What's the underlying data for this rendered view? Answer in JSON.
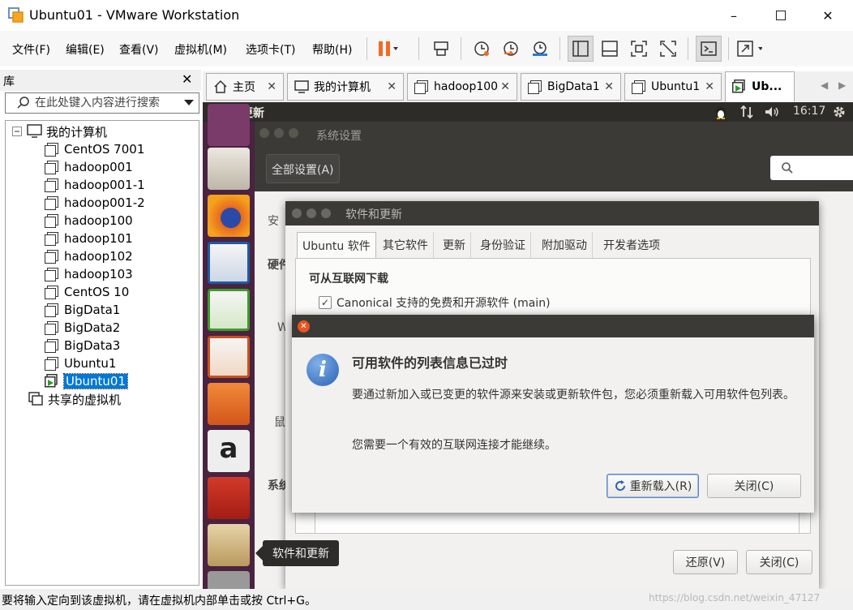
{
  "window": {
    "title": "Ubuntu01 - VMware Workstation"
  },
  "menu": {
    "file": "文件(F)",
    "edit": "编辑(E)",
    "view": "查看(V)",
    "vm": "虚拟机(M)",
    "tabs": "选项卡(T)",
    "help": "帮助(H)"
  },
  "library": {
    "title": "库",
    "search_placeholder": "在此处键入内容进行搜索",
    "root": "我的计算机",
    "items": [
      "CentOS 7001",
      "hadoop001",
      "hadoop001-1",
      "hadoop001-2",
      "hadoop100",
      "hadoop101",
      "hadoop102",
      "hadoop103",
      "CentOS 10",
      "BigData1",
      "BigData2",
      "BigData3",
      "Ubuntu1",
      "Ubuntu01"
    ],
    "selected": "Ubuntu01",
    "shared": "共享的虚拟机"
  },
  "tabs": [
    "主页",
    "我的计算机",
    "hadoop100",
    "BigData1",
    "Ubuntu1",
    "Ub..."
  ],
  "ubuntu": {
    "topbar_title": "软件和更新",
    "clock": "16:17",
    "settings_title": "系统设置",
    "all_settings": "全部设置(A)",
    "section_hardware": "硬件",
    "section_system": "系统",
    "partial_w": "W",
    "partial_mouse": "鼠",
    "partial_security": "安",
    "tooltip": "软件和更新"
  },
  "software_updates": {
    "title": "软件和更新",
    "tabs": [
      "Ubuntu 软件",
      "其它软件",
      "更新",
      "身份验证",
      "附加驱动",
      "开发者选项"
    ],
    "section": "可从互联网下载",
    "main_source": "Canonical 支持的免费和开源软件 (main)",
    "revert": "还原(V)",
    "close": "关闭(C)"
  },
  "dialog": {
    "heading": "可用软件的列表信息已过时",
    "body1": "要通过新加入或已变更的软件源来安装或更新软件包，您必须重新载入可用软件包列表。",
    "body2": "您需要一个有效的互联网连接才能继续。",
    "reload": "重新载入(R)",
    "close": "关闭(C)"
  },
  "status": {
    "text": "要将输入定向到该虚拟机，请在虚拟机内部单击或按 Ctrl+G。",
    "watermark": "https://blog.csdn.net/weixin_47127"
  },
  "colors": {
    "accent": "#0078d7",
    "pause": "#f36a22",
    "ubuntu_orange": "#e95420",
    "launcher": "#4a2340"
  }
}
